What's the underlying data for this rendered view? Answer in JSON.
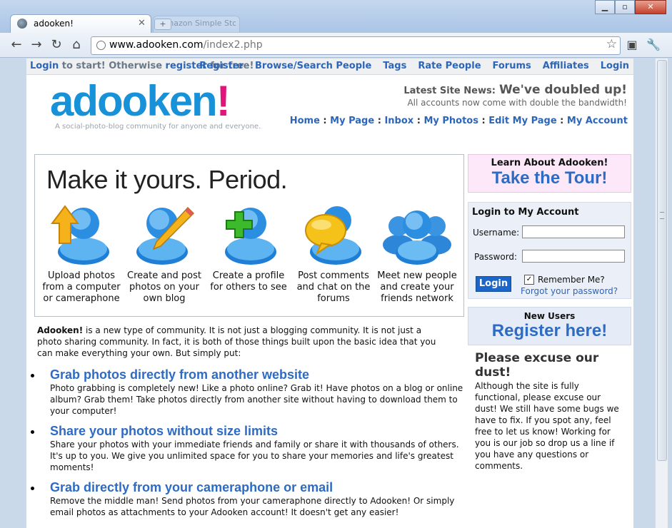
{
  "browser": {
    "tab_title": "adooken!",
    "inactive_tab_title": "Amazon Simple Storage Se",
    "url_host": "www.adooken.com",
    "url_path": "/index2.php"
  },
  "topbar": {
    "login_link": "Login",
    "text_1": " to start! Otherwise ",
    "register_link": "register",
    "text_2": " for free!",
    "nav": [
      "Register",
      "Browse/Search People",
      "Tags",
      "Rate People",
      "Forums",
      "Affiliates",
      "Login"
    ]
  },
  "header": {
    "logo_main": "adooken",
    "logo_excl": "!",
    "tagline": "A social-photo-blog community for anyone and everyone.",
    "news_label": "Latest Site News:",
    "news_headline": "We've doubled up!",
    "news_sub": "All accounts now come with double the bandwidth!",
    "user_nav": [
      "Home",
      "My Page",
      "Inbox",
      "My Photos",
      "Edit My Page",
      "My Account"
    ]
  },
  "hero": {
    "title": "Make it yours. Period.",
    "features": [
      {
        "icon": "upload-user-icon",
        "caption": [
          "Upload photos",
          "from a computer",
          "or cameraphone"
        ]
      },
      {
        "icon": "pencil-user-icon",
        "caption": [
          "Create and post",
          "photos on your",
          "own blog"
        ]
      },
      {
        "icon": "add-user-icon",
        "caption": [
          "Create a profile",
          "for others to see"
        ]
      },
      {
        "icon": "chat-user-icon",
        "caption": [
          "Post comments",
          "and chat on the",
          "forums"
        ]
      },
      {
        "icon": "group-users-icon",
        "caption": [
          "Meet new people",
          "and create your",
          "friends network"
        ]
      }
    ]
  },
  "intro": {
    "brand": "Adooken!",
    "text": " is a new type of community. It is not just a blogging community. It is not just a photo sharing community. In fact, it is both of those things built upon the basic idea that you can make everything your own. But simply put:"
  },
  "bullets": [
    {
      "title": "Grab photos directly from another website",
      "text": "Photo grabbing is completely new! Like a photo online? Grab it! Have photos on a blog or online album? Grab them! Take photos directly from another site without having to download them to your computer!"
    },
    {
      "title": "Share your photos without size limits",
      "text": "Share your photos with your immediate friends and family or share it with thousands of others. It's up to you. We give you unlimited space for you to share your memories and life's greatest moments!"
    },
    {
      "title": "Grab directly from your cameraphone or email",
      "text": "Remove the middle man! Send photos from your cameraphone directly to Adooken! Or simply email photos as attachments to your Adooken account! It doesn't get any easier!"
    }
  ],
  "sidebar": {
    "tour_small": "Learn About Adooken!",
    "tour_big": "Take the Tour!",
    "login_title": "Login to My Account",
    "username_label": "Username:",
    "password_label": "Password:",
    "login_button": "Login",
    "remember_label": "Remember Me?",
    "remember_checked": true,
    "forgot_link": "Forgot your password?",
    "new_users": "New Users",
    "register_big": "Register here!",
    "dust_title": "Please excuse our dust!",
    "dust_text": "Although the site is fully functional, please excuse our dust! We still have some bugs we have to fix. If you spot any, feel free to let us know! Working for you is our job so drop us a line if you have any questions or comments."
  },
  "colors": {
    "link_blue": "#2d66b8",
    "logo_blue": "#1792d8",
    "logo_pink": "#e0147a",
    "tour_bg": "#fce8f8",
    "login_bg": "#eaeff8"
  }
}
